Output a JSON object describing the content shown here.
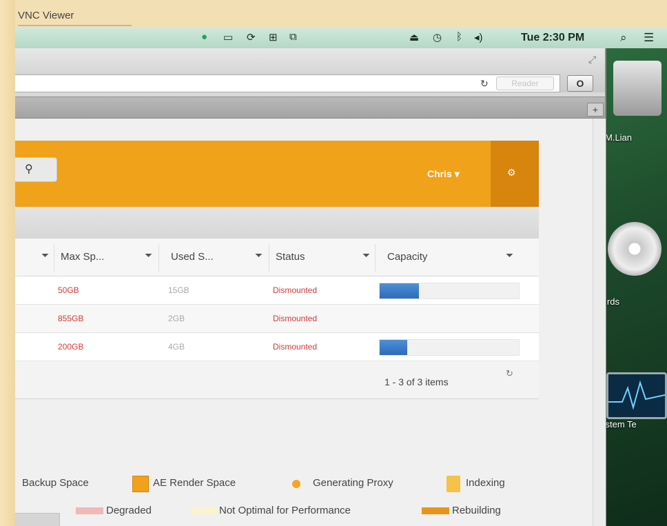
{
  "vnc": {
    "title": "VNC Viewer"
  },
  "menubar": {
    "clock": "Tue 2:30 PM",
    "icons": [
      "green-dot-icon",
      "battery-icon",
      "sync-icon",
      "grid-icon",
      "window-icon",
      "eject-icon",
      "time-machine-icon",
      "bluetooth-icon",
      "volume-icon",
      "spotlight-icon",
      "list-icon"
    ]
  },
  "browser": {
    "reader_label": "Reader",
    "o_label": "O",
    "new_tab_label": "+"
  },
  "app": {
    "user_name": "Chris",
    "user_caret": "▾"
  },
  "table": {
    "columns": [
      {
        "label": "Max Sp..."
      },
      {
        "label": "Used S..."
      },
      {
        "label": "Status"
      },
      {
        "label": "Capacity"
      }
    ],
    "rows": [
      {
        "max": "50GB",
        "used": "15GB",
        "status": "Dismounted",
        "capacity": 0.28
      },
      {
        "max": "855GB",
        "used": "2GB",
        "status": "Dismounted",
        "capacity": 0.0
      },
      {
        "max": "200GB",
        "used": "4GB",
        "status": "Dismounted",
        "capacity": 0.2
      }
    ],
    "pager": "1 - 3 of 3 items"
  },
  "legend": {
    "row1": [
      "Backup Space",
      "AE Render Space",
      "Generating Proxy",
      "Indexing"
    ],
    "row2": [
      "Degraded",
      "Not Optimal for Performance",
      "Rebuilding"
    ]
  },
  "desktop": {
    "labels": [
      "M.Lian",
      "irds",
      "ystem Te"
    ]
  },
  "colors": {
    "header": "#f0a21a",
    "header_dark": "#d7850d",
    "status_red": "#d23a3a",
    "capacity_blue": "#2f6ab7"
  }
}
